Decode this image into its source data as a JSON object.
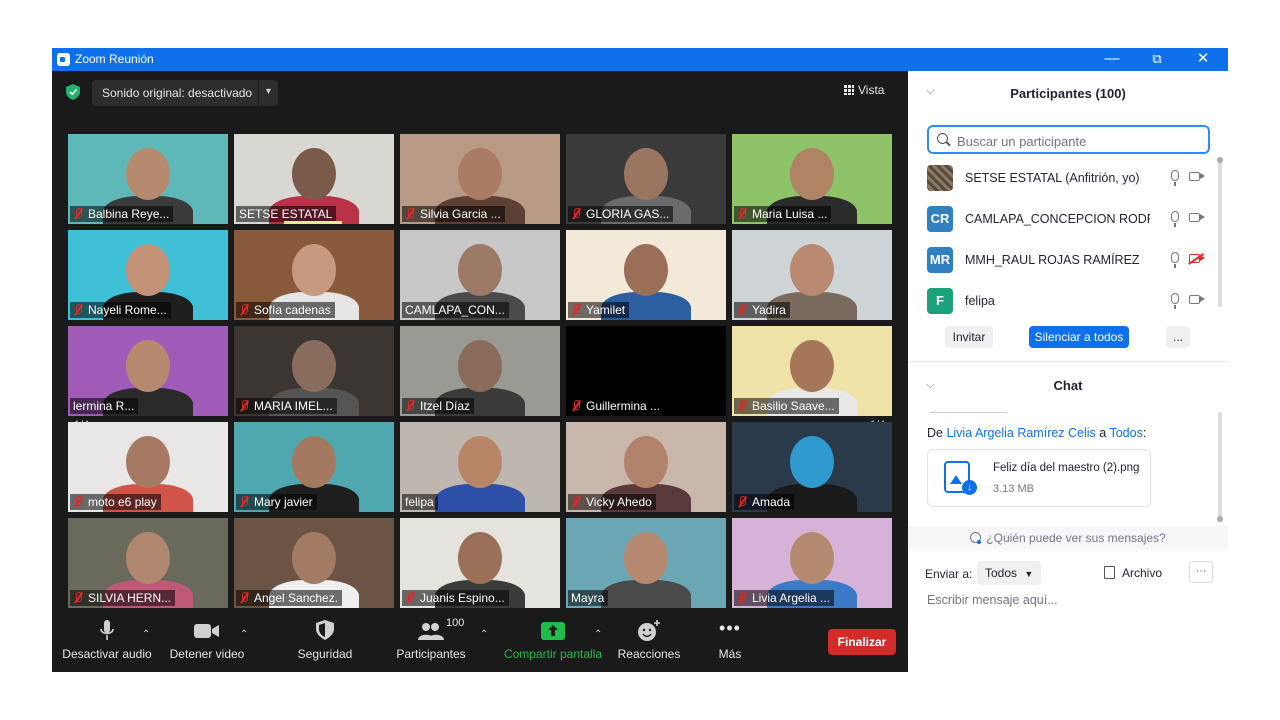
{
  "window": {
    "title": "Zoom Reunión",
    "controls": {
      "minimize": "—",
      "restore": "⧉",
      "close": "✕"
    }
  },
  "top_bar": {
    "sound": "Sonido original: desactivado",
    "view": "Vista"
  },
  "gallery": {
    "page": "1/4",
    "tiles": [
      {
        "name": "Balbina Reye...",
        "muted": true,
        "bg": "#5fb8b8",
        "skin": "#b58a6e",
        "shirt": "#3a3a3a"
      },
      {
        "name": "SETSE ESTATAL",
        "muted": false,
        "bg": "#d9d7d2",
        "skin": "#7a5a48",
        "shirt": "#b83248"
      },
      {
        "name": "Silvia Garcia ...",
        "muted": true,
        "bg": "#b89a85",
        "skin": "#a97c63",
        "shirt": "#5c4033"
      },
      {
        "name": "GLORIA GAS...",
        "muted": true,
        "bg": "#3a3a3a",
        "skin": "#9a7560",
        "shirt": "#6b6b6b"
      },
      {
        "name": "Maria Luisa ...",
        "muted": true,
        "bg": "#8fc36a",
        "skin": "#b08365",
        "shirt": "#2b2b2b"
      },
      {
        "name": "Nayeli Rome...",
        "muted": true,
        "bg": "#3fc0d6",
        "skin": "#c49377",
        "shirt": "#1f1f1f"
      },
      {
        "name": "Sofía cadenas",
        "muted": true,
        "bg": "#8a5a3c",
        "skin": "#c69a80",
        "shirt": "#e6e6e6"
      },
      {
        "name": "CAMLAPA_CON...",
        "muted": false,
        "bg": "#c8c8c8",
        "skin": "#9c7a66",
        "shirt": "#4a4a4a"
      },
      {
        "name": "Yamilet",
        "muted": true,
        "bg": "#f3e9d9",
        "skin": "#9b6e58",
        "shirt": "#2b5fa0"
      },
      {
        "name": "Yadira",
        "muted": true,
        "bg": "#cfd5d6",
        "skin": "#b98a6f",
        "shirt": "#7a6a5e"
      },
      {
        "name": "lermina R...",
        "muted": false,
        "bg": "#a05bb8",
        "skin": "#b78a70",
        "shirt": "#2a2a2a"
      },
      {
        "name": "MARIA IMEL...",
        "muted": true,
        "bg": "#3c3632",
        "skin": "#8a6c5c",
        "shirt": "#555555"
      },
      {
        "name": "Itzel Díaz",
        "muted": true,
        "bg": "#9a9a94",
        "skin": "#8a6a58",
        "shirt": "#3a3a3a"
      },
      {
        "name": "Guillermina ...",
        "muted": true,
        "bg": "#000000",
        "skin": "#000000",
        "shirt": "#000000"
      },
      {
        "name": "Basilio Saave...",
        "muted": true,
        "bg": "#efe2a6",
        "skin": "#a5765a",
        "shirt": "#e8e8e8"
      },
      {
        "name": "moto e6 play",
        "muted": true,
        "bg": "#e9e7e6",
        "skin": "#a67a62",
        "shirt": "#d0544a"
      },
      {
        "name": "Mary javier",
        "muted": true,
        "bg": "#4fa7b0",
        "skin": "#a37a60",
        "shirt": "#1f1f1f"
      },
      {
        "name": "felipa",
        "muted": false,
        "bg": "#bdb7b0",
        "skin": "#b88567",
        "shirt": "#2d4fa8"
      },
      {
        "name": "Vicky Ahedo",
        "muted": true,
        "bg": "#c9b7ab",
        "skin": "#b0836a",
        "shirt": "#5a3a3a"
      },
      {
        "name": "Amada",
        "muted": true,
        "bg": "#2a3a4a",
        "skin": "#2f9ad0",
        "shirt": "#1a1a1a"
      },
      {
        "name": "SILVIA HERN...",
        "muted": true,
        "bg": "#6a6a5c",
        "skin": "#b08870",
        "shirt": "#c05878"
      },
      {
        "name": "Angel Sanchez.",
        "muted": true,
        "bg": "#6b5444",
        "skin": "#a37a62",
        "shirt": "#efefef"
      },
      {
        "name": "Juanis Espino...",
        "muted": true,
        "bg": "#e5e3dd",
        "skin": "#9a7058",
        "shirt": "#3a3a3a"
      },
      {
        "name": "Mayra",
        "muted": false,
        "bg": "#6ca7b6",
        "skin": "#b68a70",
        "shirt": "#4a4a4a"
      },
      {
        "name": "Livia Argelia ...",
        "muted": true,
        "bg": "#d6b2d8",
        "skin": "#b48a70",
        "shirt": "#3c7ac8"
      }
    ]
  },
  "toolbar": {
    "audio": "Desactivar audio",
    "video": "Detener video",
    "security": "Seguridad",
    "participants": "Participantes",
    "participants_count": "100",
    "share": "Compartir pantalla",
    "reactions": "Reacciones",
    "more": "Más",
    "end": "Finalizar"
  },
  "participants_panel": {
    "title": "Participantes (100)",
    "search_placeholder": "Buscar un participante",
    "list": [
      {
        "initials": "",
        "name": "SETSE ESTATAL (Anfitrión, yo)",
        "avatar_color": "#6b5a4a",
        "video_off": false
      },
      {
        "initials": "CR",
        "name": "CAMLAPA_CONCEPCION RODRI...",
        "avatar_color": "#2f7fc1",
        "video_off": false
      },
      {
        "initials": "MR",
        "name": "MMH_RAUL ROJAS RAMÍREZ",
        "avatar_color": "#2f7fc1",
        "video_off": true
      },
      {
        "initials": "F",
        "name": "felipa",
        "avatar_color": "#1aa37a",
        "video_off": false
      }
    ],
    "invite": "Invitar",
    "mute_all": "Silenciar a todos",
    "more": "..."
  },
  "chat": {
    "title": "Chat",
    "from_prefix": "De ",
    "from_name": "Livia Argelia Ramírez Celis",
    "from_mid": " a ",
    "from_to": "Todos",
    "from_suffix": ":",
    "file_name": "Feliz día del maestro (2).png",
    "file_size": "3.13 MB",
    "who_sees": "¿Quién puede ver sus mensajes?",
    "send_to_label": "Enviar a:",
    "send_to_value": "Todos",
    "file_button": "Archivo",
    "more": "···",
    "input_placeholder": "Escribir mensaje aquí..."
  },
  "colors": {
    "accent": "#0e71eb",
    "end": "#d32a2a",
    "share": "#1fbd4a",
    "mute_red": "#e02828",
    "active_speaker": "#e8eb8a"
  }
}
